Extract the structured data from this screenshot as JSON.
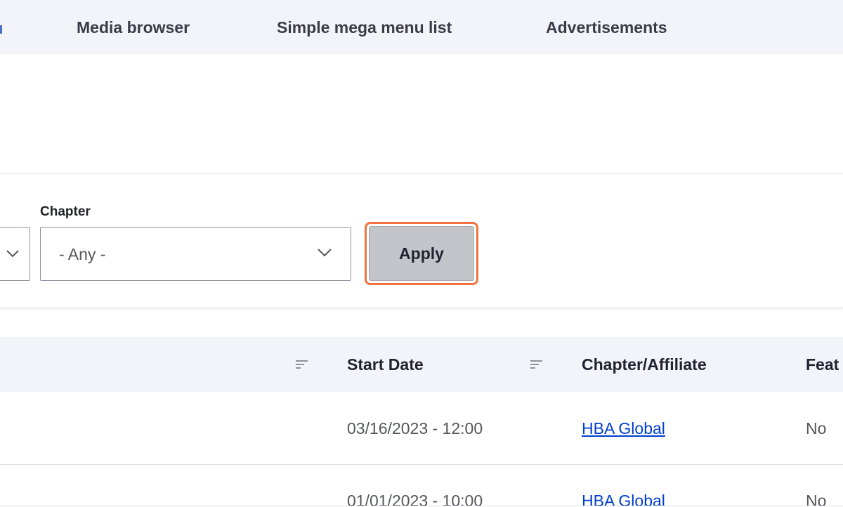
{
  "tabs": [
    {
      "label": "Media browser"
    },
    {
      "label": "Simple mega menu list"
    },
    {
      "label": "Advertisements"
    }
  ],
  "filters": {
    "chapter_label": "Chapter",
    "chapter_value": "- Any -",
    "apply_label": "Apply"
  },
  "table": {
    "headers": [
      "Start Date",
      "Chapter/Affiliate",
      "Feat"
    ],
    "rows": [
      {
        "start_date": "03/16/2023 - 12:00",
        "chapter": "HBA Global",
        "featured": "No"
      },
      {
        "start_date": "01/01/2023 - 10:00",
        "chapter": "HBA Global",
        "featured": "No"
      }
    ]
  },
  "colors": {
    "accent_highlight": "#f1733f",
    "link": "#003ecc",
    "header_bg": "#f3f4f9",
    "button_bg": "#c4c5cb"
  },
  "icons": [
    "chevron-down-icon",
    "sort-icon"
  ]
}
